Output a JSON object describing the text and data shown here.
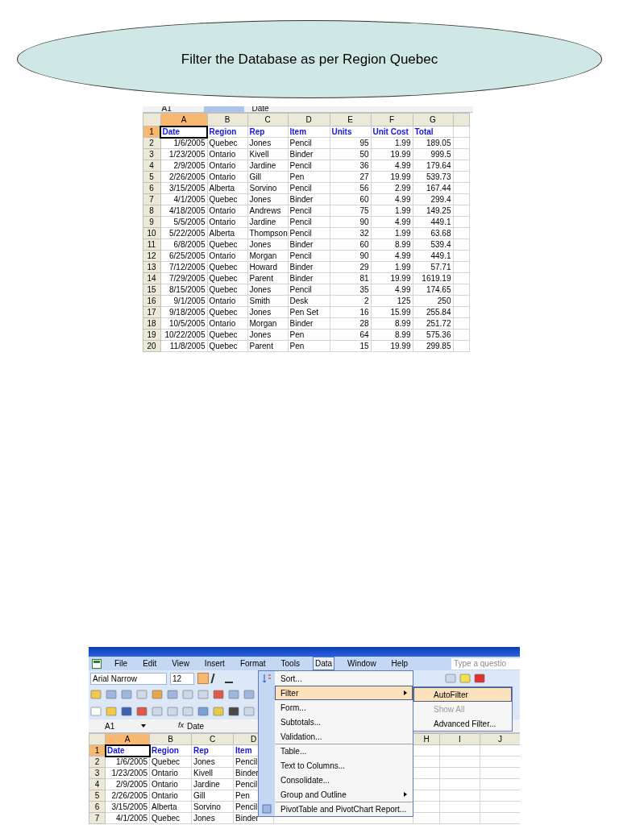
{
  "callout": {
    "text": "Filter the Database as per Region Quebec"
  },
  "sheet1": {
    "name_box": "A1",
    "formula": "Date",
    "columns": [
      {
        "label": "A",
        "selected": true
      },
      {
        "label": "B",
        "selected": false
      },
      {
        "label": "C",
        "selected": false
      },
      {
        "label": "D",
        "selected": false
      },
      {
        "label": "E",
        "selected": false
      },
      {
        "label": "F",
        "selected": false
      },
      {
        "label": "G",
        "selected": false
      }
    ],
    "rows": [
      {
        "number": "1",
        "selected": true,
        "kind": "header",
        "cells": [
          "Date",
          "Region",
          "Rep",
          "Item",
          "Units",
          "Unit Cost",
          "Total"
        ]
      },
      {
        "number": "2",
        "selected": false,
        "kind": "data",
        "cells": [
          "1/6/2005",
          "Quebec",
          "Jones",
          "Pencil",
          "95",
          "1.99",
          "189.05"
        ]
      },
      {
        "number": "3",
        "selected": false,
        "kind": "data",
        "cells": [
          "1/23/2005",
          "Ontario",
          "Kivell",
          "Binder",
          "50",
          "19.99",
          "999.5"
        ]
      },
      {
        "number": "4",
        "selected": false,
        "kind": "data",
        "cells": [
          "2/9/2005",
          "Ontario",
          "Jardine",
          "Pencil",
          "36",
          "4.99",
          "179.64"
        ]
      },
      {
        "number": "5",
        "selected": false,
        "kind": "data",
        "cells": [
          "2/26/2005",
          "Ontario",
          "Gill",
          "Pen",
          "27",
          "19.99",
          "539.73"
        ]
      },
      {
        "number": "6",
        "selected": false,
        "kind": "data",
        "cells": [
          "3/15/2005",
          "Alberta",
          "Sorvino",
          "Pencil",
          "56",
          "2.99",
          "167.44"
        ]
      },
      {
        "number": "7",
        "selected": false,
        "kind": "data",
        "cells": [
          "4/1/2005",
          "Quebec",
          "Jones",
          "Binder",
          "60",
          "4.99",
          "299.4"
        ]
      },
      {
        "number": "8",
        "selected": false,
        "kind": "data",
        "cells": [
          "4/18/2005",
          "Ontario",
          "Andrews",
          "Pencil",
          "75",
          "1.99",
          "149.25"
        ]
      },
      {
        "number": "9",
        "selected": false,
        "kind": "data",
        "cells": [
          "5/5/2005",
          "Ontario",
          "Jardine",
          "Pencil",
          "90",
          "4.99",
          "449.1"
        ]
      },
      {
        "number": "10",
        "selected": false,
        "kind": "data",
        "cells": [
          "5/22/2005",
          "Alberta",
          "Thompson",
          "Pencil",
          "32",
          "1.99",
          "63.68"
        ]
      },
      {
        "number": "11",
        "selected": false,
        "kind": "data",
        "cells": [
          "6/8/2005",
          "Quebec",
          "Jones",
          "Binder",
          "60",
          "8.99",
          "539.4"
        ]
      },
      {
        "number": "12",
        "selected": false,
        "kind": "data",
        "cells": [
          "6/25/2005",
          "Ontario",
          "Morgan",
          "Pencil",
          "90",
          "4.99",
          "449.1"
        ]
      },
      {
        "number": "13",
        "selected": false,
        "kind": "data",
        "cells": [
          "7/12/2005",
          "Quebec",
          "Howard",
          "Binder",
          "29",
          "1.99",
          "57.71"
        ]
      },
      {
        "number": "14",
        "selected": false,
        "kind": "data",
        "cells": [
          "7/29/2005",
          "Quebec",
          "Parent",
          "Binder",
          "81",
          "19.99",
          "1619.19"
        ]
      },
      {
        "number": "15",
        "selected": false,
        "kind": "data",
        "cells": [
          "8/15/2005",
          "Quebec",
          "Jones",
          "Pencil",
          "35",
          "4.99",
          "174.65"
        ]
      },
      {
        "number": "16",
        "selected": false,
        "kind": "data",
        "cells": [
          "9/1/2005",
          "Ontario",
          "Smith",
          "Desk",
          "2",
          "125",
          "250"
        ]
      },
      {
        "number": "17",
        "selected": false,
        "kind": "data",
        "cells": [
          "9/18/2005",
          "Quebec",
          "Jones",
          "Pen Set",
          "16",
          "15.99",
          "255.84"
        ]
      },
      {
        "number": "18",
        "selected": false,
        "kind": "data",
        "cells": [
          "10/5/2005",
          "Ontario",
          "Morgan",
          "Binder",
          "28",
          "8.99",
          "251.72"
        ]
      },
      {
        "number": "19",
        "selected": false,
        "kind": "data",
        "cells": [
          "10/22/2005",
          "Quebec",
          "Jones",
          "Pen",
          "64",
          "8.99",
          "575.36"
        ]
      },
      {
        "number": "20",
        "selected": false,
        "kind": "data",
        "cells": [
          "11/8/2005",
          "Quebec",
          "Parent",
          "Pen",
          "15",
          "19.99",
          "299.85"
        ]
      }
    ]
  },
  "sheet2": {
    "menu_bar": [
      {
        "label": "File",
        "selected": false
      },
      {
        "label": "Edit",
        "selected": false
      },
      {
        "label": "View",
        "selected": false
      },
      {
        "label": "Insert",
        "selected": false
      },
      {
        "label": "Format",
        "selected": false
      },
      {
        "label": "Tools",
        "selected": false
      },
      {
        "label": "Data",
        "selected": true
      },
      {
        "label": "Window",
        "selected": false
      },
      {
        "label": "Help",
        "selected": false
      }
    ],
    "question_box": {
      "placeholder": "Type a questio"
    },
    "font": "Arial Narrow",
    "font_size": "12",
    "name_box": "A1",
    "function_label": "fx",
    "formula": "Date",
    "columns": [
      {
        "label": "A",
        "selected": true
      },
      {
        "label": "B",
        "selected": false
      },
      {
        "label": "C",
        "selected": false
      },
      {
        "label": "D",
        "selected": false
      },
      {
        "label": "H",
        "selected": false
      },
      {
        "label": "I",
        "selected": false
      },
      {
        "label": "J",
        "selected": false
      }
    ],
    "rows": [
      {
        "number": "1",
        "kind": "header",
        "cells": [
          "Date",
          "Region",
          "Rep",
          "Item"
        ]
      },
      {
        "number": "2",
        "kind": "data",
        "cells": [
          "1/6/2005",
          "Quebec",
          "Jones",
          "Pencil"
        ]
      },
      {
        "number": "3",
        "kind": "data",
        "cells": [
          "1/23/2005",
          "Ontario",
          "Kivell",
          "Binder"
        ]
      },
      {
        "number": "4",
        "kind": "data",
        "cells": [
          "2/9/2005",
          "Ontario",
          "Jardine",
          "Pencil"
        ]
      },
      {
        "number": "5",
        "kind": "data",
        "cells": [
          "2/26/2005",
          "Ontario",
          "Gill",
          "Pen"
        ]
      },
      {
        "number": "6",
        "kind": "data",
        "cells": [
          "3/15/2005",
          "Alberta",
          "Sorvino",
          "Pencil"
        ]
      },
      {
        "number": "7",
        "kind": "data",
        "cells": [
          "4/1/2005",
          "Quebec",
          "Jones",
          "Binder"
        ]
      }
    ],
    "data_menu": [
      {
        "label": "Sort...",
        "selected": false,
        "submenu": false,
        "divider_before": false
      },
      {
        "label": "Filter",
        "selected": true,
        "submenu": true,
        "divider_before": false
      },
      {
        "label": "Form...",
        "selected": false,
        "submenu": false,
        "divider_before": false
      },
      {
        "label": "Subtotals...",
        "selected": false,
        "submenu": false,
        "divider_before": false
      },
      {
        "label": "Validation...",
        "selected": false,
        "submenu": false,
        "divider_before": false
      },
      {
        "label": "Table...",
        "selected": false,
        "submenu": false,
        "divider_before": true
      },
      {
        "label": "Text to Columns...",
        "selected": false,
        "submenu": false,
        "divider_before": false
      },
      {
        "label": "Consolidate...",
        "selected": false,
        "submenu": false,
        "divider_before": false
      },
      {
        "label": "Group and Outline",
        "selected": false,
        "submenu": true,
        "divider_before": false
      },
      {
        "label": "PivotTable and PivotChart Report...",
        "selected": false,
        "submenu": false,
        "divider_before": true
      }
    ],
    "filter_submenu": [
      {
        "label": "AutoFilter",
        "selected": true,
        "disabled": false
      },
      {
        "label": "Show All",
        "selected": false,
        "disabled": true
      },
      {
        "label": "Advanced Filter...",
        "selected": false,
        "disabled": false
      }
    ]
  }
}
